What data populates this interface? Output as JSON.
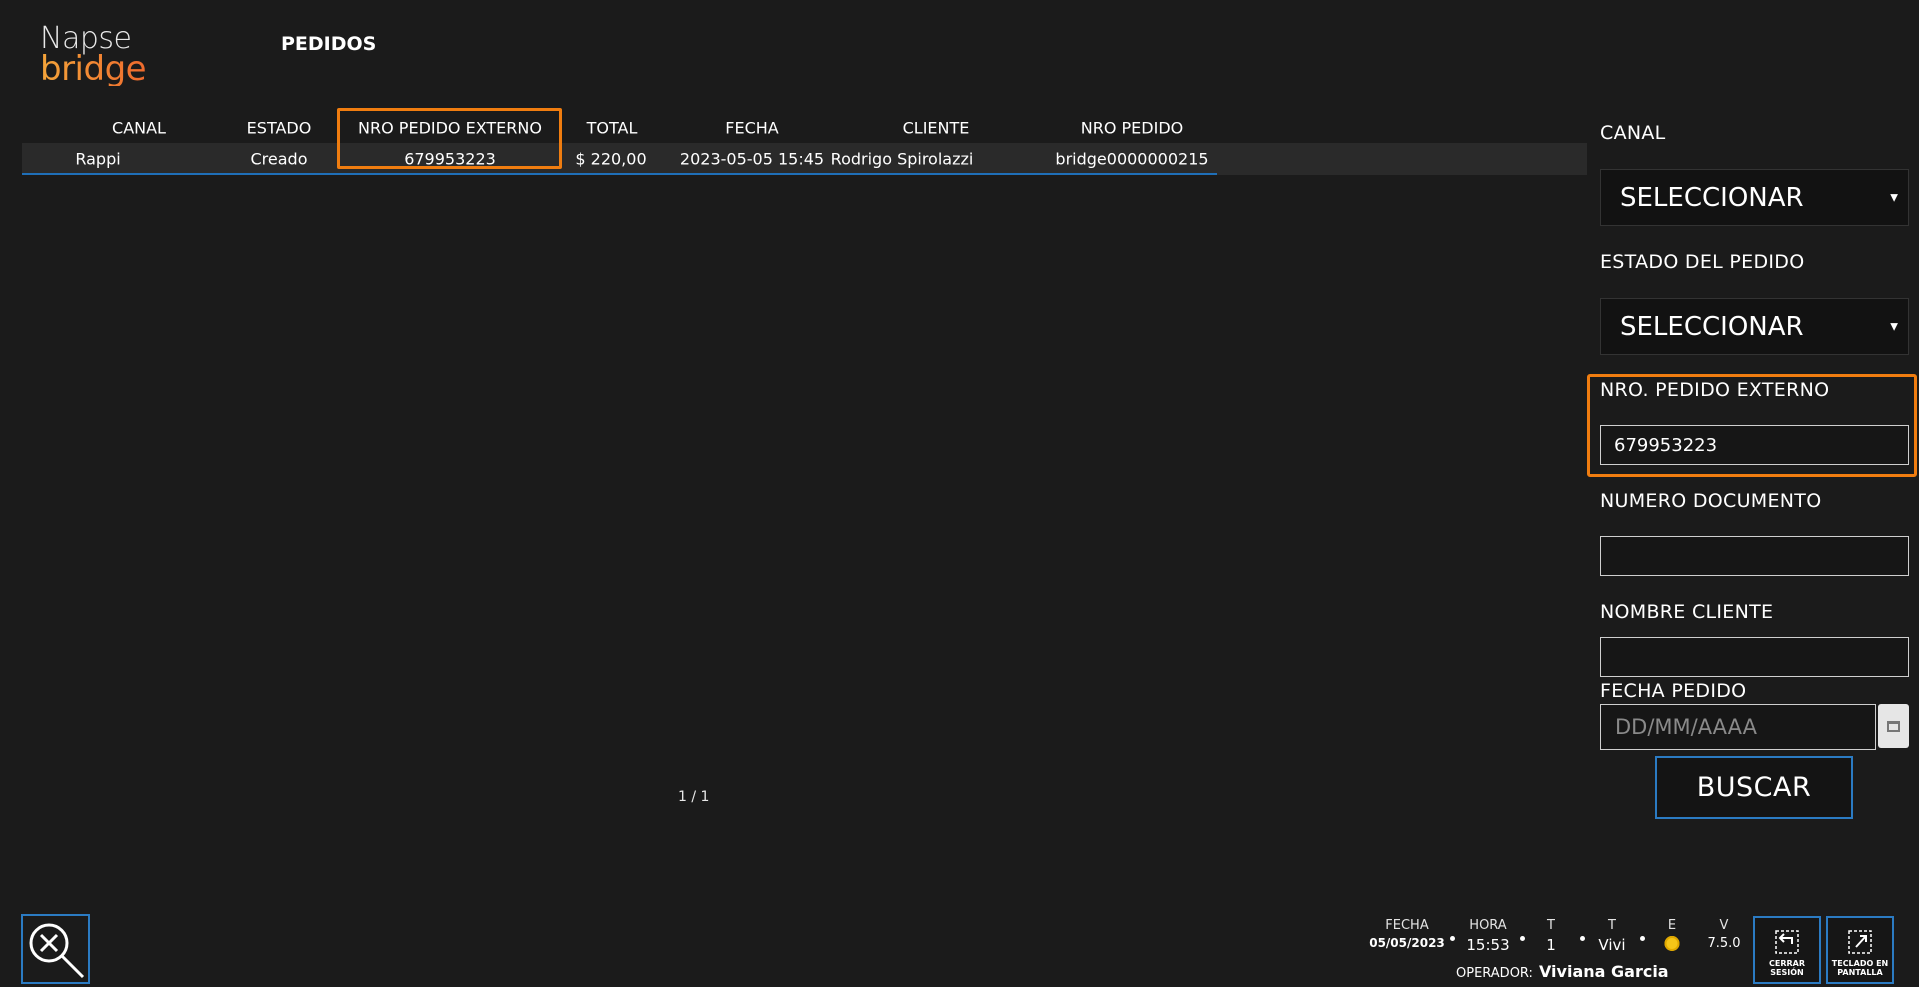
{
  "brand": {
    "line1": "Napse",
    "line2": "bridge"
  },
  "page_title": "PEDIDOS",
  "table": {
    "columns": [
      "CANAL",
      "ESTADO",
      "NRO PEDIDO EXTERNO",
      "TOTAL",
      "FECHA",
      "CLIENTE",
      "NRO PEDIDO"
    ],
    "rows": [
      [
        "Rappi",
        "Creado",
        "679953223",
        "$ 220,00",
        "2023-05-05 15:45",
        "Rodrigo Spirolazzi",
        "bridge0000000215"
      ]
    ]
  },
  "pager": "1 / 1",
  "filters": {
    "canal_label": "CANAL",
    "canal_value": "SELECCIONAR",
    "estado_label": "ESTADO DEL PEDIDO",
    "estado_value": "SELECCIONAR",
    "ext_label": "NRO. PEDIDO EXTERNO",
    "ext_value": "679953223",
    "doc_label": "NUMERO DOCUMENTO",
    "doc_value": "",
    "cliente_label": "NOMBRE CLIENTE",
    "cliente_value": "",
    "fecha_label": "FECHA PEDIDO",
    "fecha_placeholder": "DD/MM/AAAA",
    "search_label": "BUSCAR"
  },
  "status": {
    "fecha_k": "FECHA",
    "fecha_v": "05/05/2023",
    "hora_k": "HORA",
    "hora_v": "15:53",
    "t1_k": "T",
    "t1_v": "1",
    "t2_k": "T",
    "t2_v": "Vivi",
    "e_k": "E",
    "v_k": "V",
    "v_v": "7.5.0",
    "operator_k": "OPERADOR:",
    "operator_v": "Viviana Garcia"
  },
  "buttons": {
    "logout": "CERRAR SESIÓN",
    "keyboard": "TECLADO EN PANTALLA"
  },
  "colors": {
    "highlight": "#f07d10",
    "accent": "#2b7bc3",
    "background": "#1b1b1b"
  }
}
